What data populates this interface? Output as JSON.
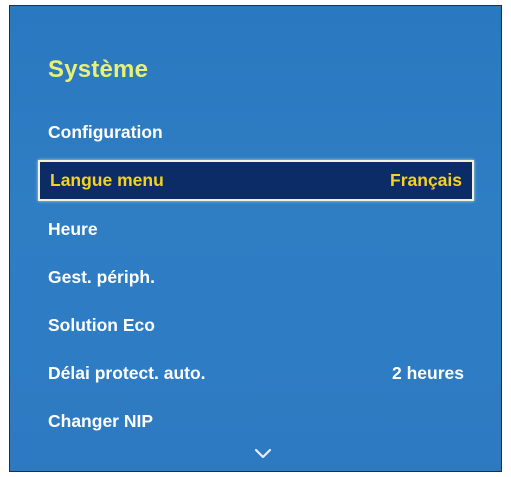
{
  "menu": {
    "title": "Système",
    "items": [
      {
        "label": "Configuration",
        "value": ""
      },
      {
        "label": "Langue menu",
        "value": "Français",
        "selected": true
      },
      {
        "label": "Heure",
        "value": ""
      },
      {
        "label": "Gest. périph.",
        "value": ""
      },
      {
        "label": "Solution Eco",
        "value": ""
      },
      {
        "label": "Délai protect. auto.",
        "value": "2 heures"
      },
      {
        "label": "Changer NIP",
        "value": ""
      }
    ],
    "scroll_indicator": "chevron-down-icon"
  },
  "colors": {
    "panel_background": "#2d7ac2",
    "title_text": "#e9f07a",
    "item_text": "#ffffff",
    "selected_background": "#0b2c66",
    "selected_text": "#f4d21f",
    "selected_border": "#f2f2d8"
  }
}
